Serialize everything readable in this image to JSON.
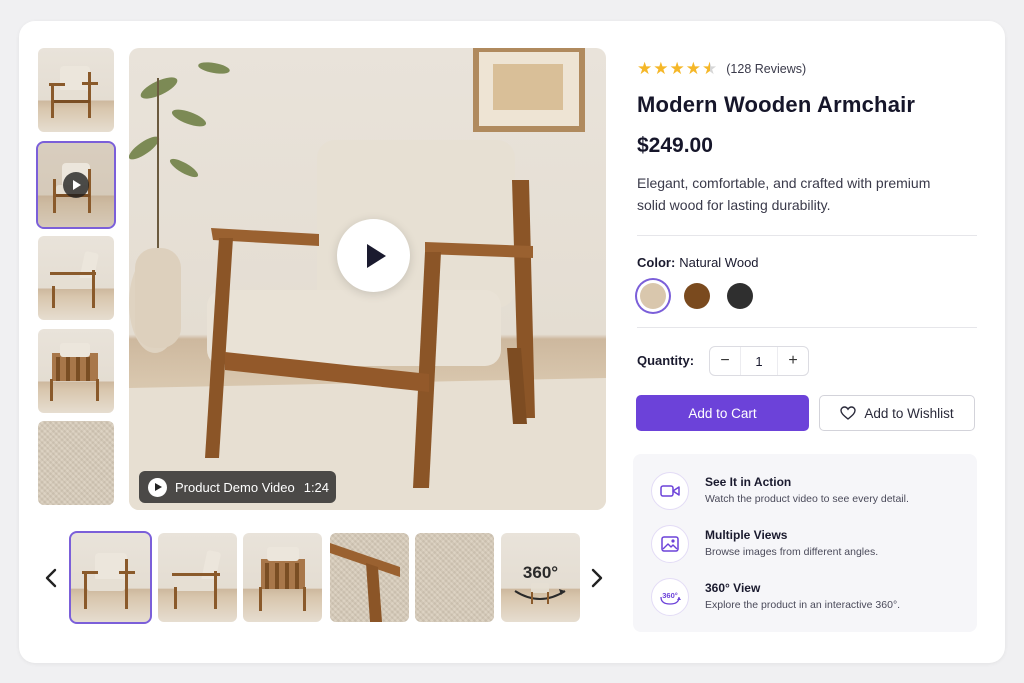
{
  "product": {
    "rating": 4.5,
    "reviews_text": "(128 Reviews)",
    "title": "Modern Wooden Armchair",
    "price": "$249.00",
    "description": "Elegant, comfortable, and crafted with premium solid wood for lasting durability."
  },
  "media": {
    "video_label": "Product Demo Video",
    "video_duration": "1:24",
    "selected_side_thumb": 1,
    "selected_bottom_thumb": 0,
    "bottom_360_label": "360°"
  },
  "color": {
    "label": "Color:",
    "selected_name": "Natural Wood",
    "swatches": [
      "#d9c7ad",
      "#7a4a1e",
      "#2f2f2f"
    ]
  },
  "quantity": {
    "label": "Quantity:",
    "value": "1",
    "minus": "−",
    "plus": "+"
  },
  "actions": {
    "add_to_cart": "Add to Cart",
    "add_to_wishlist": "Add to Wishlist"
  },
  "features": [
    {
      "icon": "video-camera-icon",
      "title": "See It in Action",
      "desc": "Watch the product video to see every detail."
    },
    {
      "icon": "image-gallery-icon",
      "title": "Multiple Views",
      "desc": "Browse images from different angles."
    },
    {
      "icon": "rotate-360-icon",
      "title": "360° View",
      "desc": "Explore the product in an interactive 360°."
    }
  ],
  "colors": {
    "accent": "#6c42d9",
    "star": "#f5b728"
  }
}
